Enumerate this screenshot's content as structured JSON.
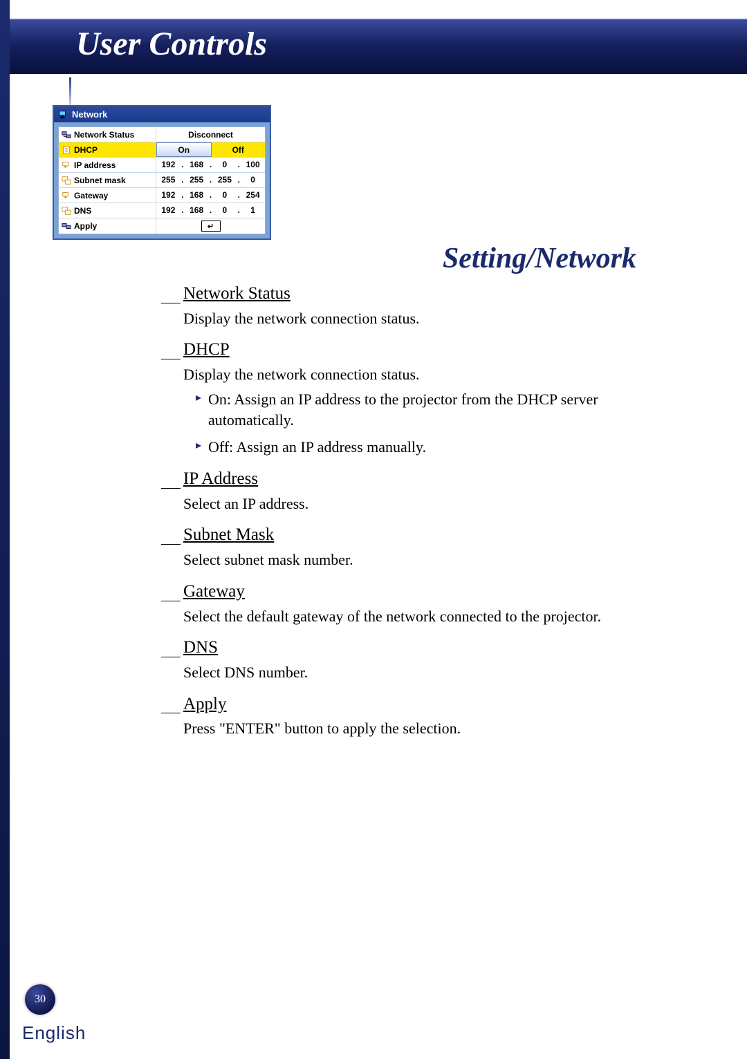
{
  "header": {
    "title": "User Controls"
  },
  "section_title": "Setting/Network",
  "osd": {
    "title": "Network",
    "rows": {
      "status": {
        "label": "Network Status",
        "value": "Disconnect"
      },
      "dhcp": {
        "label": "DHCP",
        "on": "On",
        "off": "Off"
      },
      "ip": {
        "label": "IP address",
        "o1": "192",
        "o2": "168",
        "o3": "0",
        "o4": "100"
      },
      "subnet": {
        "label": "Subnet mask",
        "o1": "255",
        "o2": "255",
        "o3": "255",
        "o4": "0"
      },
      "gateway": {
        "label": "Gateway",
        "o1": "192",
        "o2": "168",
        "o3": "0",
        "o4": "254"
      },
      "dns": {
        "label": "DNS",
        "o1": "192",
        "o2": "168",
        "o3": "0",
        "o4": "1"
      },
      "apply": {
        "label": "Apply",
        "btn": "↵"
      }
    }
  },
  "doc": {
    "h1": "Network Status",
    "p1": "Display the network connection status.",
    "h2": "DHCP",
    "p2": "Display the network connection status.",
    "b1": "On: Assign an IP address to the projector from the DHCP server automatically.",
    "b2": "Off: Assign an IP address manually.",
    "h3": "IP Address",
    "p3": "Select an IP address.",
    "h4": "Subnet Mask",
    "p4": "Select subnet mask number.",
    "h5": "Gateway",
    "p5": "Select the default gateway of the network connected to the projector.",
    "h6": "DNS",
    "p6": "Select DNS number.",
    "h7": "Apply",
    "p7": "Press \"ENTER\" button to apply the selection."
  },
  "footer": {
    "page": "30",
    "lang": "English"
  }
}
